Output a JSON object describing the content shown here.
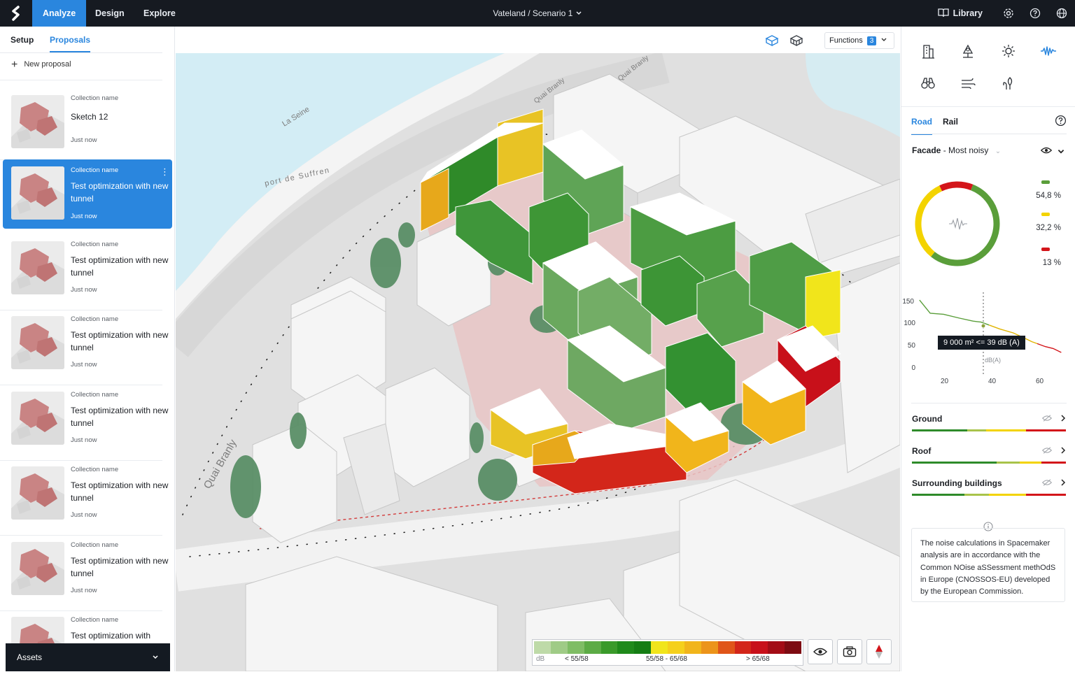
{
  "topbar": {
    "nav_tabs": [
      "Analyze",
      "Design",
      "Explore"
    ],
    "project_title": "Vateland / Scenario 1",
    "library_label": "Library",
    "icons": [
      "spacemaker-logo",
      "chevron-down-icon",
      "library-icon",
      "gear-icon",
      "help-icon",
      "globe-icon"
    ]
  },
  "left_panel": {
    "tabs": [
      "Setup",
      "Proposals"
    ],
    "active_tab": "Proposals",
    "new_proposal_label": "New proposal",
    "proposals": [
      {
        "collection": "Collection name",
        "title": "Sketch 12",
        "time": "Just now",
        "selected": false
      },
      {
        "collection": "Collection name",
        "title": "Test optimization with new tunnel",
        "time": "Just now",
        "selected": true
      },
      {
        "collection": "Collection name",
        "title": "Test optimization with new tunnel",
        "time": "Just now",
        "selected": false
      },
      {
        "collection": "Collection name",
        "title": "Test optimization with new tunnel",
        "time": "Just now",
        "selected": false
      },
      {
        "collection": "Collection name",
        "title": "Test optimization with new tunnel",
        "time": "Just now",
        "selected": false
      },
      {
        "collection": "Collection name",
        "title": "Test optimization with new tunnel",
        "time": "Just now",
        "selected": false
      },
      {
        "collection": "Collection name",
        "title": "Test optimization with new tunnel",
        "time": "Just now",
        "selected": false
      },
      {
        "collection": "Collection name",
        "title": "Test optimization with",
        "time": "",
        "selected": false
      }
    ],
    "assets_label": "Assets"
  },
  "view_toolbar": {
    "functions_label": "Functions",
    "functions_count": "3"
  },
  "map": {
    "labels": [
      "La Seine",
      "port de Suffren",
      "Quai Branly",
      "Quai Branly",
      "Quai Branly"
    ],
    "legend": {
      "unit": "dB",
      "ranges": [
        "< 55/58",
        "55/58 - 65/68",
        "> 65/68"
      ],
      "colors": [
        "#bedaa8",
        "#9fcb86",
        "#7fbd65",
        "#5cab45",
        "#3a9a2a",
        "#1f8a1b",
        "#157d14",
        "#f1e51b",
        "#f5d01c",
        "#f1b51b",
        "#ec941a",
        "#e05519",
        "#d3261a",
        "#c8101a",
        "#a30c16",
        "#7d0b12"
      ]
    }
  },
  "right_panel": {
    "tabs": [
      "Road",
      "Rail"
    ],
    "active_tab": "Road",
    "facade_title": "Facade",
    "facade_mode": "Most noisy",
    "donut": [
      {
        "label": "54,8 %",
        "value": 54.8,
        "color": "#5a9e3a"
      },
      {
        "label": "32,2 %",
        "value": 32.2,
        "color": "#f3d300"
      },
      {
        "label": "13 %",
        "value": 13.0,
        "color": "#d3151a"
      }
    ],
    "chart_data": {
      "type": "line",
      "x_ticks": [
        "20",
        "40",
        "60"
      ],
      "y_ticks": [
        "150",
        "100",
        "50",
        "0"
      ],
      "x_unit": "dB(A)",
      "tooltip": "9 000 m² <= 39 dB (A)",
      "series": [
        {
          "color": "#5a9e3a",
          "points": [
            [
              13,
              147
            ],
            [
              17,
              120
            ],
            [
              22,
              118
            ],
            [
              28,
              110
            ],
            [
              33,
              104
            ],
            [
              36,
              102
            ],
            [
              39,
              96
            ]
          ]
        },
        {
          "color": "#e0b400",
          "points": [
            [
              39,
              96
            ],
            [
              43,
              88
            ],
            [
              48,
              80
            ],
            [
              52,
              70
            ],
            [
              55,
              62
            ],
            [
              57,
              58
            ]
          ]
        },
        {
          "color": "#d3151a",
          "points": [
            [
              57,
              58
            ],
            [
              60,
              52
            ],
            [
              63,
              48
            ],
            [
              66,
              40
            ]
          ]
        }
      ],
      "xlim": [
        12,
        68
      ],
      "ylim": [
        0,
        160
      ]
    },
    "sections": [
      {
        "label": "Ground",
        "strip": [
          [
            "#2e8b2a",
            0.36
          ],
          [
            "#a8c34a",
            0.12
          ],
          [
            "#f3d300",
            0.26
          ],
          [
            "#d3151a",
            0.26
          ]
        ]
      },
      {
        "label": "Roof",
        "strip": [
          [
            "#2e8b2a",
            0.55
          ],
          [
            "#a8c34a",
            0.15
          ],
          [
            "#f3d300",
            0.14
          ],
          [
            "#d3151a",
            0.16
          ]
        ]
      },
      {
        "label": "Surrounding buildings",
        "strip": [
          [
            "#2e8b2a",
            0.34
          ],
          [
            "#a8c34a",
            0.16
          ],
          [
            "#f3d300",
            0.24
          ],
          [
            "#d3151a",
            0.26
          ]
        ]
      }
    ],
    "info": "The noise calculations in Spacemaker analysis are in accordance with the Common NOise aSSessment methOdS in Europe (CNOSSOS-EU) developed by the European Commission."
  }
}
